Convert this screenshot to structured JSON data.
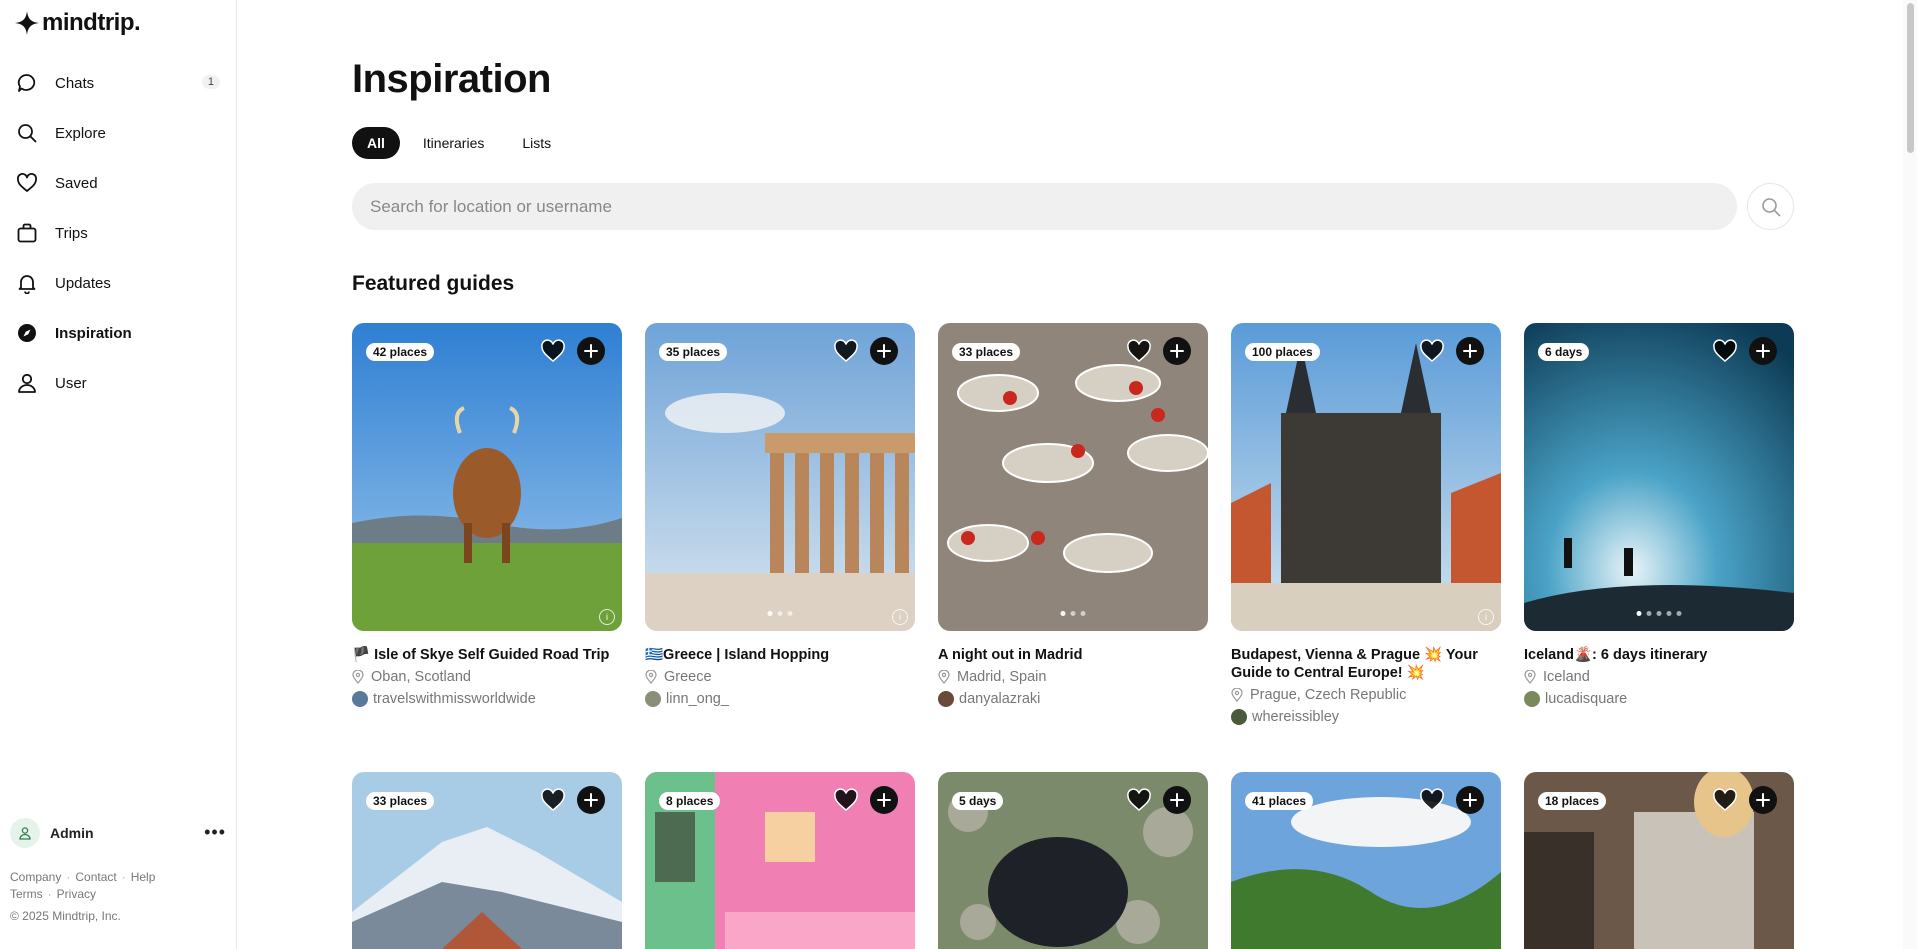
{
  "app": {
    "name": "mindtrip."
  },
  "sidebar": {
    "items": [
      {
        "label": "Chats",
        "badge": "1",
        "icon": "chat-bubble-icon"
      },
      {
        "label": "Explore",
        "icon": "search-icon"
      },
      {
        "label": "Saved",
        "icon": "heart-icon"
      },
      {
        "label": "Trips",
        "icon": "suitcase-icon"
      },
      {
        "label": "Updates",
        "icon": "bell-icon"
      },
      {
        "label": "Inspiration",
        "icon": "compass-icon",
        "active": true
      },
      {
        "label": "User",
        "icon": "user-icon"
      }
    ],
    "admin_name": "Admin",
    "more_label": "•••",
    "footer": {
      "company": "Company",
      "contact": "Contact",
      "help": "Help",
      "terms": "Terms",
      "privacy": "Privacy",
      "sep": "·"
    },
    "copyright": "© 2025 Mindtrip, Inc."
  },
  "main": {
    "title": "Inspiration",
    "tabs": [
      "All",
      "Itineraries",
      "Lists"
    ],
    "active_tab": "All",
    "search": {
      "placeholder": "Search for location or username",
      "value": ""
    },
    "section_title": "Featured guides"
  },
  "cards": [
    {
      "badge": "42 places",
      "title": "🏴 Isle of Skye Self Guided Road Trip",
      "location": "Oban, Scotland",
      "user": "travelswithmissworldwide",
      "dots": 0
    },
    {
      "badge": "35 places",
      "title": "🇬🇷Greece | Island Hopping",
      "location": "Greece",
      "user": "linn_ong_",
      "dots": 3
    },
    {
      "badge": "33 places",
      "title": "A night out in Madrid",
      "location": "Madrid, Spain",
      "user": "danyalazraki",
      "dots": 3
    },
    {
      "badge": "100 places",
      "title": "Budapest, Vienna & Prague 💥 Your Guide to Central Europe! 💥",
      "location": "Prague, Czech Republic",
      "user": "whereissibley",
      "dots": 0
    },
    {
      "badge": "6 days",
      "title": "Iceland🌋: 6 days itinerary",
      "location": "Iceland",
      "user": "lucadisquare",
      "dots": 5
    }
  ],
  "cards_row2": [
    {
      "badge": "33 places"
    },
    {
      "badge": "8 places"
    },
    {
      "badge": "5 days"
    },
    {
      "badge": "41 places"
    },
    {
      "badge": "18 places"
    }
  ],
  "colors": {
    "accent": "#111111",
    "muted": "#777777",
    "search_bg": "#f0f0f0"
  }
}
